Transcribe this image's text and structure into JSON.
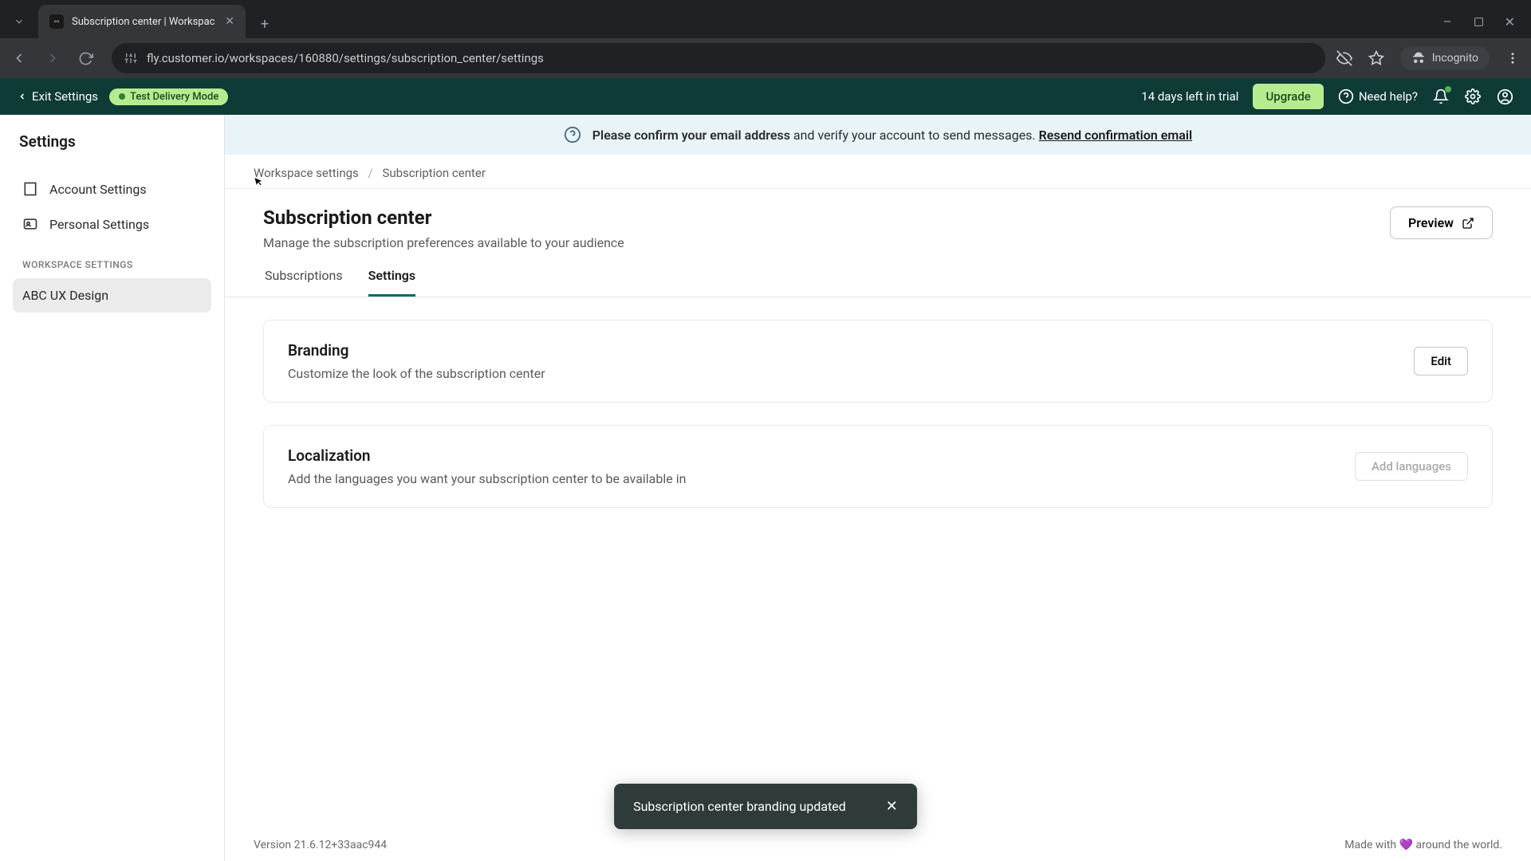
{
  "browser": {
    "tab_title": "Subscription center | Workspac",
    "url": "fly.customer.io/workspaces/160880/settings/subscription_center/settings",
    "incognito_label": "Incognito"
  },
  "topbar": {
    "exit_label": "Exit Settings",
    "delivery_mode": "Test Delivery Mode",
    "trial_text": "14 days left in trial",
    "upgrade_label": "Upgrade",
    "help_label": "Need help?"
  },
  "sidebar": {
    "title": "Settings",
    "items": [
      {
        "label": "Account Settings"
      },
      {
        "label": "Personal Settings"
      }
    ],
    "section_label": "WORKSPACE SETTINGS",
    "workspace_name": "ABC UX Design"
  },
  "banner": {
    "strong": "Please confirm your email address",
    "rest": " and verify your account to send messages. ",
    "link": "Resend confirmation email"
  },
  "breadcrumb": {
    "parent": "Workspace settings",
    "current": "Subscription center"
  },
  "page": {
    "title": "Subscription center",
    "subtitle": "Manage the subscription preferences available to your audience",
    "preview_label": "Preview"
  },
  "tabs": [
    {
      "label": "Subscriptions",
      "active": false
    },
    {
      "label": "Settings",
      "active": true
    }
  ],
  "cards": {
    "branding": {
      "title": "Branding",
      "desc": "Customize the look of the subscription center",
      "button": "Edit"
    },
    "localization": {
      "title": "Localization",
      "desc": "Add the languages you want your subscription center to be available in",
      "button": "Add languages"
    }
  },
  "footer": {
    "version": "Version 21.6.12+33aac944",
    "made_prefix": "Made with ",
    "made_suffix": " around the world."
  },
  "toast": {
    "message": "Subscription center branding updated"
  }
}
